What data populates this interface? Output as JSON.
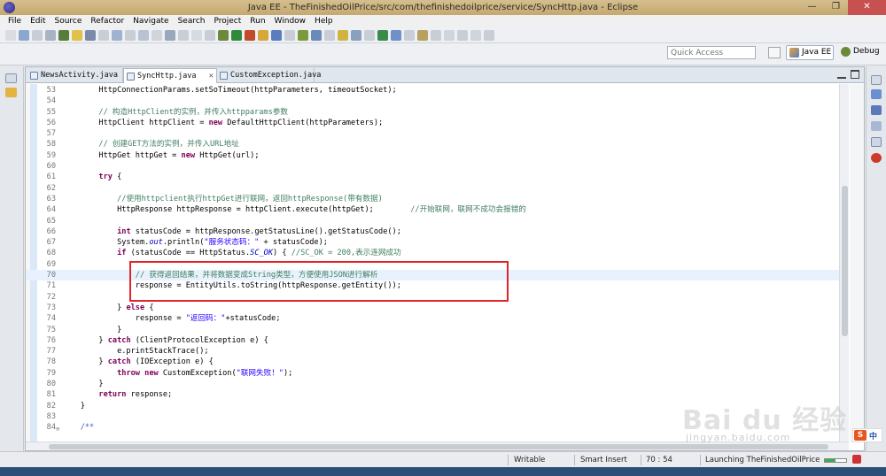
{
  "window": {
    "title": "Java EE - TheFinishedOilPrice/src/com/thefinishedoilprice/service/SyncHttp.java - Eclipse",
    "minimize": "—",
    "maximize": "❐",
    "close": "✕"
  },
  "menu": [
    "File",
    "Edit",
    "Source",
    "Refactor",
    "Navigate",
    "Search",
    "Project",
    "Run",
    "Window",
    "Help"
  ],
  "quick_access": {
    "placeholder": "Quick Access"
  },
  "perspectives": {
    "javaee": "Java EE",
    "debug": "Debug"
  },
  "tabs": [
    {
      "label": "NewsActivity.java",
      "active": false
    },
    {
      "label": "SyncHttp.java",
      "active": true,
      "close": "✕"
    },
    {
      "label": "CustomException.java",
      "active": false
    }
  ],
  "code_lines": [
    {
      "n": "53",
      "text": "        HttpConnectionParams.setSoTimeout(httpParameters, timeoutSocket);"
    },
    {
      "n": "54",
      "text": ""
    },
    {
      "n": "55",
      "text": "        // 构造HttpClient的实例，并传入httpparams参数"
    },
    {
      "n": "56",
      "text": "        HttpClient httpClient = new DefaultHttpClient(httpParameters);"
    },
    {
      "n": "57",
      "text": ""
    },
    {
      "n": "58",
      "text": "        // 创建GET方法的实例，并传入URL地址"
    },
    {
      "n": "59",
      "text": "        HttpGet httpGet = new HttpGet(url);"
    },
    {
      "n": "60",
      "text": ""
    },
    {
      "n": "61",
      "text": "        try {"
    },
    {
      "n": "62",
      "text": ""
    },
    {
      "n": "63",
      "text": "            //使用httpclient执行httpGet进行联网，返回httpResponse(带有数据)"
    },
    {
      "n": "64",
      "text": "            HttpResponse httpResponse = httpClient.execute(httpGet);        //开始联网，联网不成功会报错的"
    },
    {
      "n": "65",
      "text": ""
    },
    {
      "n": "66",
      "text": "            int statusCode = httpResponse.getStatusLine().getStatusCode();"
    },
    {
      "n": "67",
      "text": "            System.out.println(\"服务状态码：\" + statusCode);"
    },
    {
      "n": "68",
      "text": "            if (statusCode == HttpStatus.SC_OK) { //SC_OK = 200,表示连网成功"
    },
    {
      "n": "69",
      "text": ""
    },
    {
      "n": "70",
      "text": "                // 获得返回结果，并将数据变成String类型，方便使用JSON进行解析",
      "current": true
    },
    {
      "n": "71",
      "text": "                response = EntityUtils.toString(httpResponse.getEntity());"
    },
    {
      "n": "72",
      "text": ""
    },
    {
      "n": "73",
      "text": "            } else {"
    },
    {
      "n": "74",
      "text": "                response = \"返回码：\"+statusCode;"
    },
    {
      "n": "75",
      "text": "            }"
    },
    {
      "n": "76",
      "text": "        } catch (ClientProtocolException e) {"
    },
    {
      "n": "77",
      "text": "            e.printStackTrace();"
    },
    {
      "n": "78",
      "text": "        } catch (IOException e) {"
    },
    {
      "n": "79",
      "text": "            throw new CustomException(\"联网失败！\");"
    },
    {
      "n": "80",
      "text": "        }"
    },
    {
      "n": "81",
      "text": "        return response;"
    },
    {
      "n": "82",
      "text": "    }"
    },
    {
      "n": "83",
      "text": ""
    },
    {
      "n": "84",
      "text": "    /**",
      "fold": true
    }
  ],
  "status": {
    "writable": "Writable",
    "insert_mode": "Smart Insert",
    "cursor": "70 : 54",
    "task": "Launching TheFinishedOilPrice",
    "progress": 0.5
  },
  "watermark": {
    "text": "Bai du 经验",
    "url": "jingyan.baidu.com"
  },
  "ime": {
    "logo": "S",
    "lang": "中"
  },
  "colors": {
    "titlebar": "#c8ad73",
    "highlight": "#e0242a",
    "keyword": "#7f0055",
    "comment": "#3f7f5f",
    "string": "#2a00ff",
    "field": "#0000c0"
  }
}
